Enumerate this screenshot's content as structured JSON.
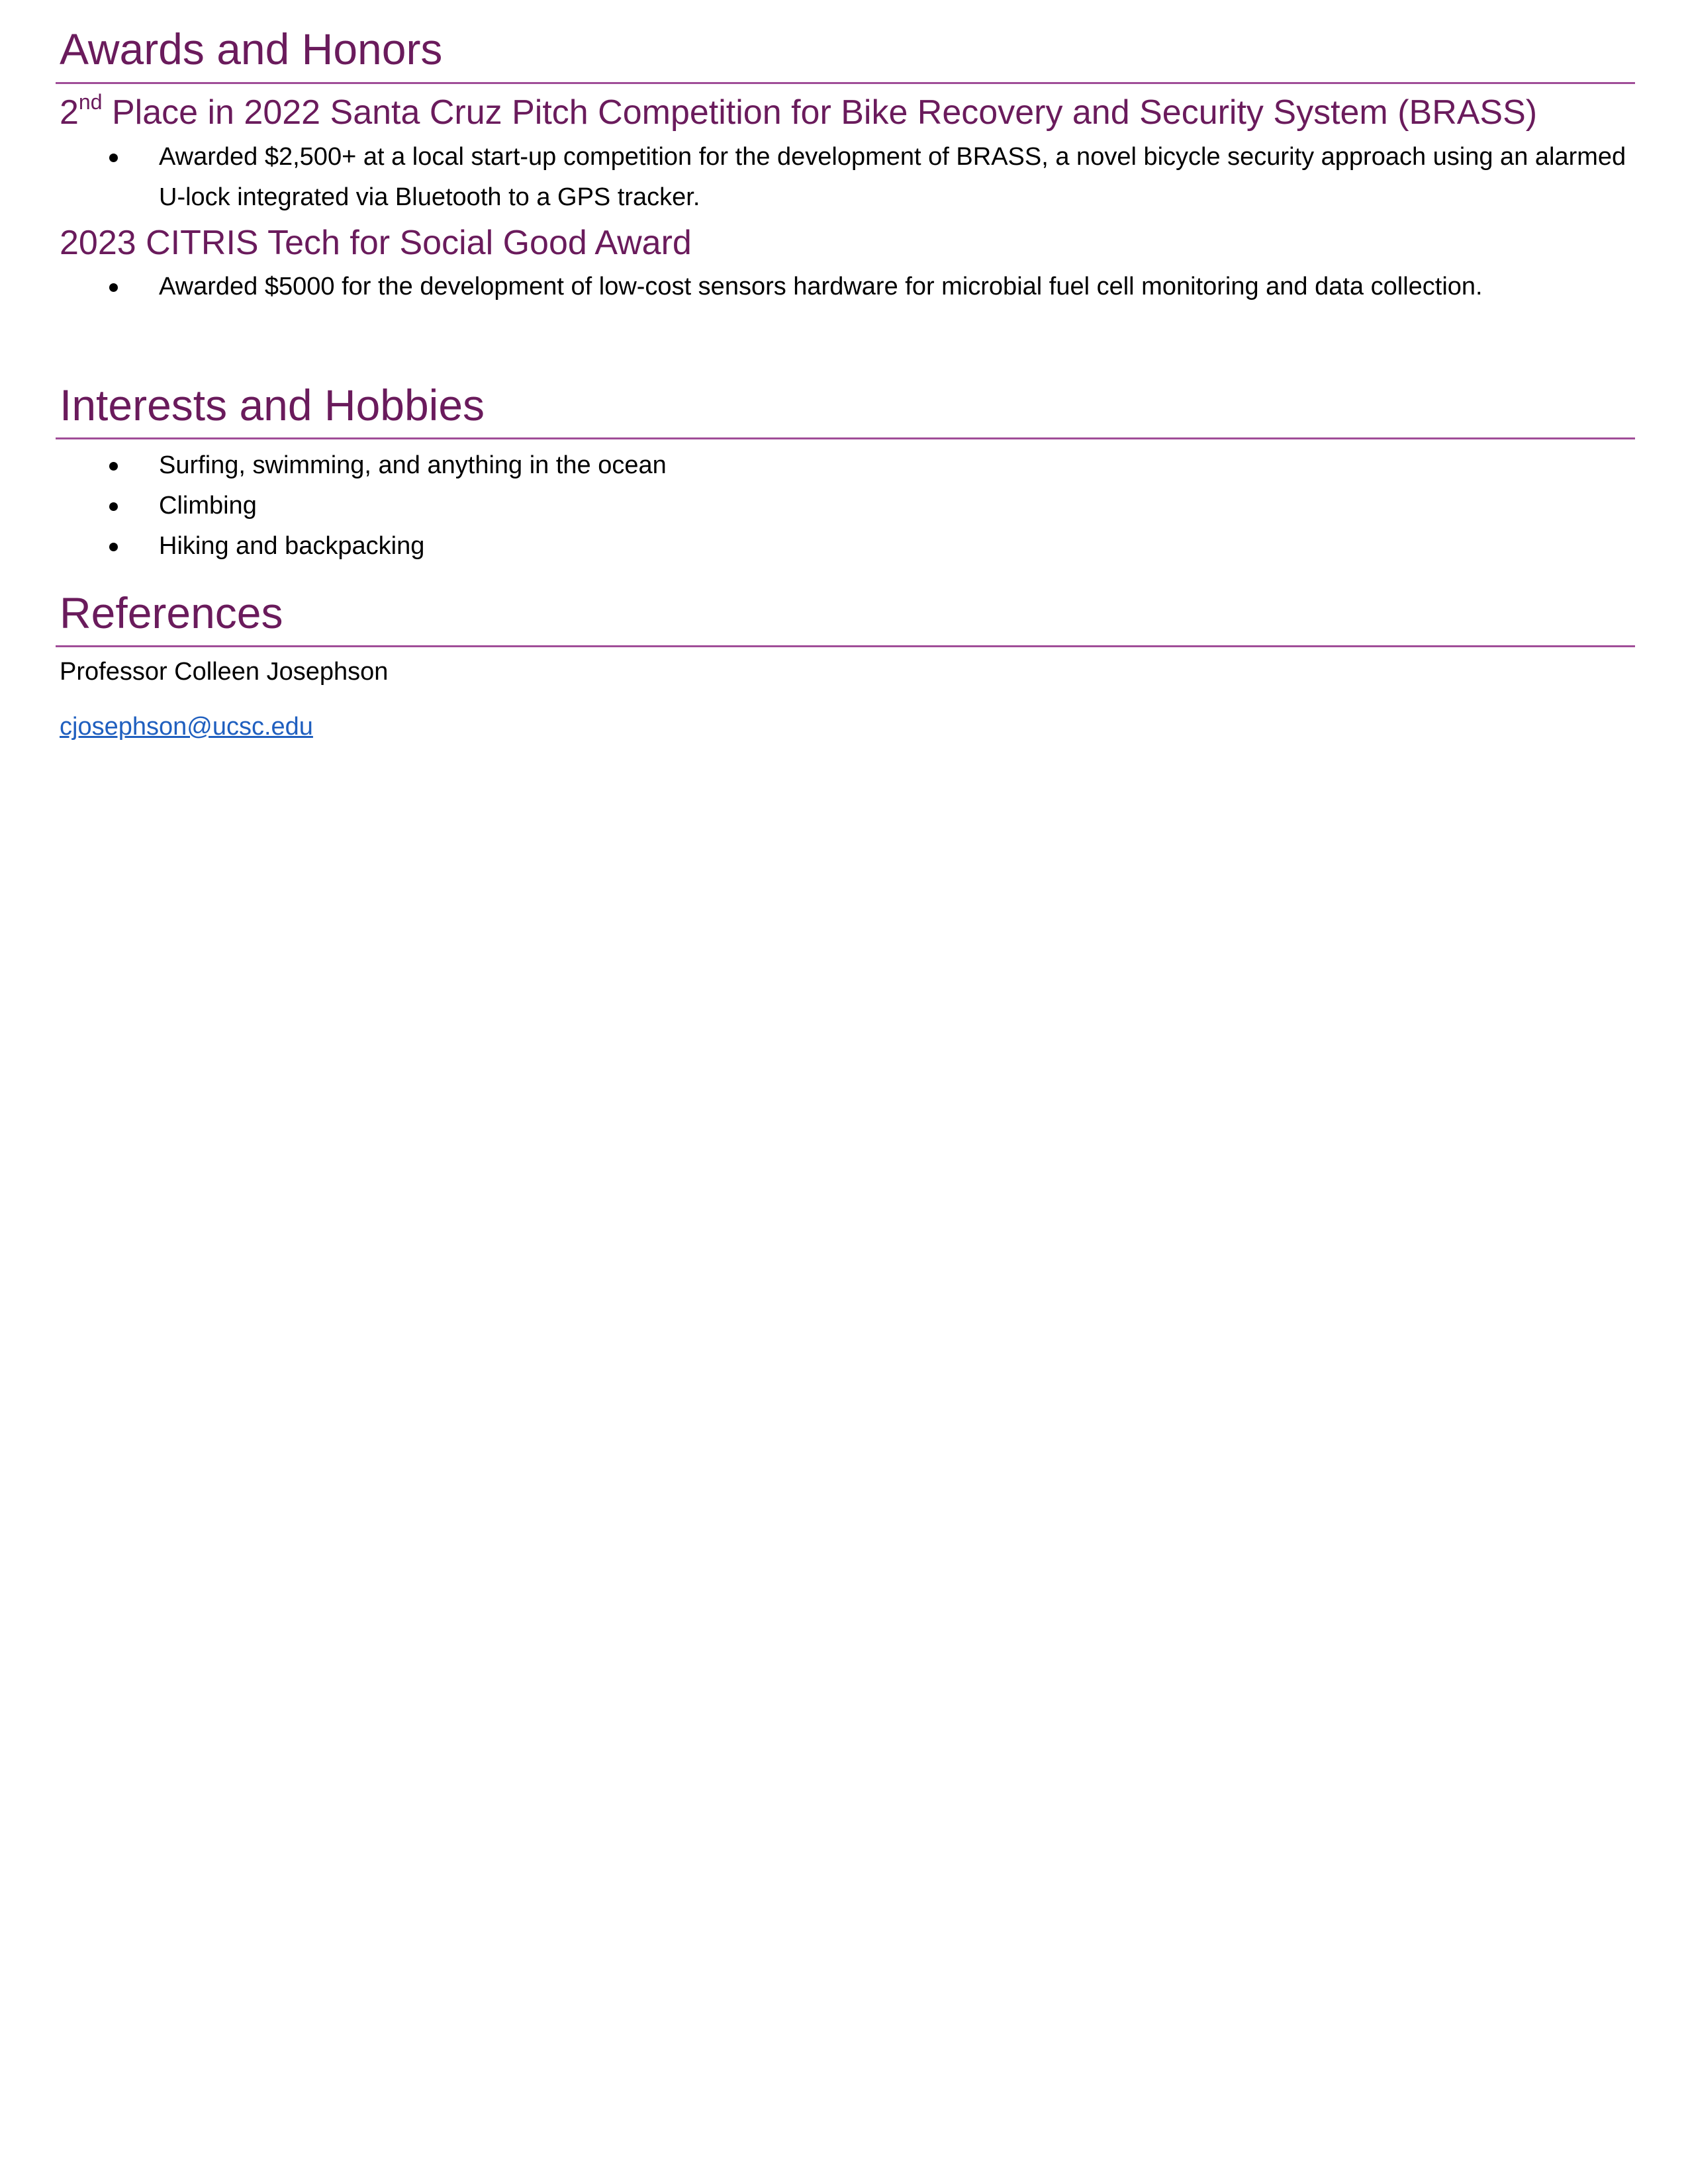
{
  "awards": {
    "heading": "Awards and Honors",
    "items": [
      {
        "title_prefix": "2",
        "title_sup": "nd",
        "title_rest": " Place in 2022 Santa Cruz Pitch Competition for Bike Recovery and Security System (BRASS)",
        "bullets": [
          "Awarded $2,500+ at a local start-up competition for the development of BRASS, a novel bicycle security approach using an alarmed U-lock integrated via Bluetooth to a GPS tracker."
        ]
      },
      {
        "title": "2023 CITRIS Tech for Social Good Award",
        "bullets": [
          "Awarded $5000 for the development of low-cost sensors hardware for microbial fuel cell monitoring and data collection."
        ]
      }
    ]
  },
  "interests": {
    "heading": "Interests and Hobbies",
    "items": [
      "Surfing, swimming, and anything in the ocean",
      "Climbing",
      "Hiking and backpacking"
    ]
  },
  "references": {
    "heading": "References",
    "name": "Professor Colleen Josephson",
    "email": "cjosephson@ucsc.edu"
  },
  "colors": {
    "heading": "#6a1b5c",
    "rule": "#a04d98",
    "link": "#1f5fbf",
    "text": "#000000"
  }
}
